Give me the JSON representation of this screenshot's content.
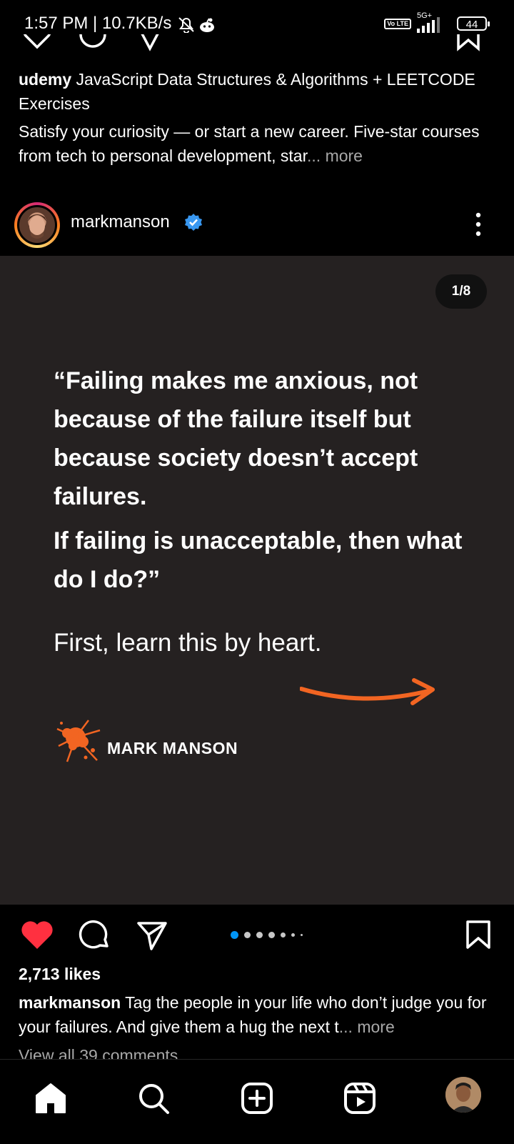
{
  "status_bar": {
    "time_speed": "1:57 PM | 10.7KB/s",
    "volte_label": "Vo LTE",
    "network_label": "5G+",
    "battery": "44"
  },
  "ad": {
    "advertiser": "udemy",
    "title": "JavaScript Data Structures & Algorithms + LEETCODE Exercises",
    "body": "Satisfy your curiosity — or start a new career. Five-star courses from tech to personal development, star",
    "ellipsis": "...",
    "more": "more"
  },
  "post": {
    "username": "markmanson",
    "verified": true,
    "page_indicator": "1/8",
    "quote_part1": "“Failing makes me anxious, not because of the failure itself but because society doesn’t accept failures.",
    "quote_part2": "If failing is unacceptable, then what do I do?”",
    "learn_line": "First, learn this by heart.",
    "brand": "MARK MANSON",
    "accent_color": "#f26522",
    "liked": true,
    "carousel": {
      "total": 8,
      "current": 1
    },
    "likes": "2,713 likes",
    "caption_user": "markmanson",
    "caption_text": "Tag the people in your life who don’t judge you for your failures. And give them a hug the next t",
    "caption_ellipsis": "...",
    "caption_more": "more",
    "view_comments": "View all 39 comments"
  },
  "icons": {
    "heart": "heart-icon",
    "comment": "comment-icon",
    "share": "paper-plane-icon",
    "save": "bookmark-icon",
    "menu": "more-vertical-icon"
  },
  "bottom_nav": [
    "home",
    "search",
    "create",
    "reels",
    "profile"
  ]
}
